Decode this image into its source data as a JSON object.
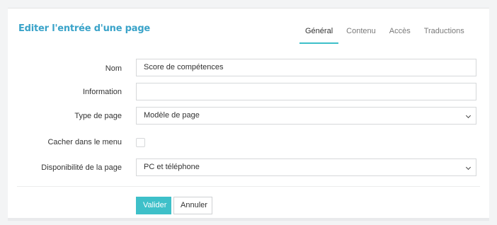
{
  "form": {
    "title": "Editer l'entrée d'une page",
    "tabs": [
      {
        "label": "Général",
        "active": true
      },
      {
        "label": "Contenu",
        "active": false
      },
      {
        "label": "Accès",
        "active": false
      },
      {
        "label": "Traductions",
        "active": false
      }
    ],
    "fields": {
      "nom": {
        "label": "Nom",
        "value": "Score de compétences"
      },
      "information": {
        "label": "Information",
        "value": ""
      },
      "type_de_page": {
        "label": "Type de page",
        "value": "Modèle de page"
      },
      "cacher_menu": {
        "label": "Cacher dans le menu",
        "checked": false
      },
      "disponibilite": {
        "label": "Disponibilité de la page",
        "value": "PC et téléphone"
      }
    },
    "buttons": {
      "submit": "Valider",
      "cancel": "Annuler"
    }
  },
  "colors": {
    "accent": "#3ec0c9",
    "title": "#3aa3c9"
  }
}
